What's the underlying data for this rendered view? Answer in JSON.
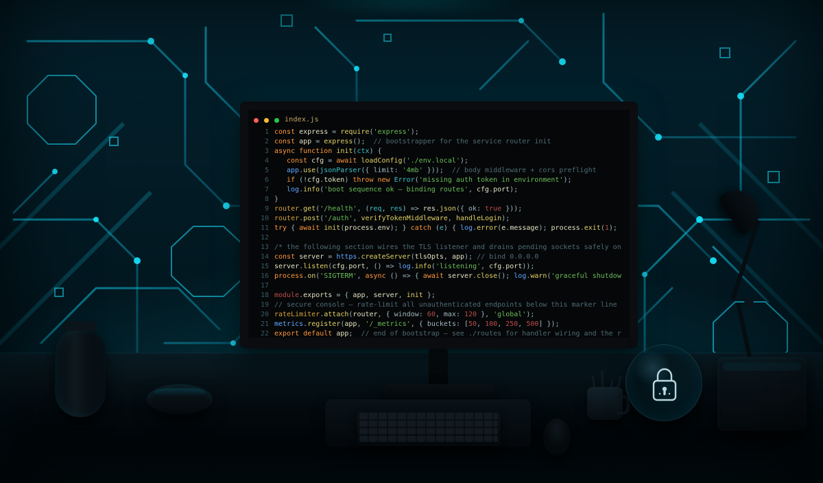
{
  "editor": {
    "title": "index.js",
    "lines": [
      {
        "n": 1,
        "ind": 0,
        "spans": [
          [
            "kw",
            "const "
          ],
          [
            "name",
            "express"
          ],
          [
            "op",
            " = "
          ],
          [
            "fn",
            "require"
          ],
          [
            "op",
            "("
          ],
          [
            "str",
            "'express'"
          ],
          [
            "op",
            ");"
          ]
        ]
      },
      {
        "n": 2,
        "ind": 0,
        "spans": [
          [
            "kw",
            "const "
          ],
          [
            "name",
            "app"
          ],
          [
            "op",
            " = "
          ],
          [
            "fn",
            "express"
          ],
          [
            "op",
            "();  "
          ],
          [
            "cm",
            "// bootstrapper for the service router init"
          ]
        ]
      },
      {
        "n": 3,
        "ind": 0,
        "spans": [
          [
            "kw",
            "async function "
          ],
          [
            "fn",
            "init"
          ],
          [
            "op",
            "("
          ],
          [
            "ty",
            "ctx"
          ],
          [
            "op",
            ") {"
          ]
        ]
      },
      {
        "n": 4,
        "ind": 1,
        "spans": [
          [
            "kw",
            "const "
          ],
          [
            "name",
            "cfg"
          ],
          [
            "op",
            " = "
          ],
          [
            "kw",
            "await "
          ],
          [
            "fn",
            "loadConfig"
          ],
          [
            "op",
            "("
          ],
          [
            "str",
            "'./env.local'"
          ],
          [
            "op",
            ");"
          ]
        ]
      },
      {
        "n": 5,
        "ind": 1,
        "spans": [
          [
            "blue",
            "app"
          ],
          [
            "op",
            "."
          ],
          [
            "fn",
            "use"
          ],
          [
            "op",
            "("
          ],
          [
            "ty",
            "jsonParser"
          ],
          [
            "op",
            "({ limit: "
          ],
          [
            "str",
            "'4mb'"
          ],
          [
            "op",
            " }));  "
          ],
          [
            "cm",
            "// body middleware + cors preflight"
          ]
        ]
      },
      {
        "n": 6,
        "ind": 1,
        "spans": [
          [
            "kw",
            "if"
          ],
          [
            "op",
            " (!"
          ],
          [
            "name",
            "cfg"
          ],
          [
            "op",
            "."
          ],
          [
            "name",
            "token"
          ],
          [
            "op",
            ") "
          ],
          [
            "kw",
            "throw new "
          ],
          [
            "ty",
            "Error"
          ],
          [
            "op",
            "("
          ],
          [
            "str",
            "'missing auth token in environment'"
          ],
          [
            "op",
            ");"
          ]
        ]
      },
      {
        "n": 7,
        "ind": 1,
        "spans": [
          [
            "blue",
            "log"
          ],
          [
            "op",
            "."
          ],
          [
            "fn",
            "info"
          ],
          [
            "op",
            "("
          ],
          [
            "str",
            "'boot sequence ok — binding routes'"
          ],
          [
            "op",
            ", "
          ],
          [
            "name",
            "cfg"
          ],
          [
            "op",
            "."
          ],
          [
            "name",
            "port"
          ],
          [
            "op",
            ");"
          ]
        ]
      },
      {
        "n": 8,
        "ind": 0,
        "spans": [
          [
            "op",
            "}"
          ]
        ]
      },
      {
        "n": 9,
        "ind": 0,
        "spans": [
          [
            "gold",
            "router"
          ],
          [
            "op",
            "."
          ],
          [
            "fn",
            "get"
          ],
          [
            "op",
            "("
          ],
          [
            "str",
            "'/health'"
          ],
          [
            "op",
            ", ("
          ],
          [
            "ty",
            "req"
          ],
          [
            "op",
            ", "
          ],
          [
            "ty",
            "res"
          ],
          [
            "op",
            ") => "
          ],
          [
            "name",
            "res"
          ],
          [
            "op",
            "."
          ],
          [
            "fn",
            "json"
          ],
          [
            "op",
            "({ ok: "
          ],
          [
            "lit",
            "true"
          ],
          [
            "op",
            " }));"
          ]
        ]
      },
      {
        "n": 10,
        "ind": 0,
        "spans": [
          [
            "gold",
            "router"
          ],
          [
            "op",
            "."
          ],
          [
            "fn",
            "post"
          ],
          [
            "op",
            "("
          ],
          [
            "str",
            "'/auth'"
          ],
          [
            "op",
            ", "
          ],
          [
            "fn",
            "verifyTokenMiddleware"
          ],
          [
            "op",
            ", "
          ],
          [
            "fn",
            "handleLogin"
          ],
          [
            "op",
            ");"
          ]
        ]
      },
      {
        "n": 11,
        "ind": 0,
        "spans": [
          [
            "kw",
            "try"
          ],
          [
            "op",
            " { "
          ],
          [
            "kw",
            "await "
          ],
          [
            "fn",
            "init"
          ],
          [
            "op",
            "("
          ],
          [
            "name",
            "process"
          ],
          [
            "op",
            "."
          ],
          [
            "name",
            "env"
          ],
          [
            "op",
            "); } "
          ],
          [
            "kw",
            "catch"
          ],
          [
            "op",
            " ("
          ],
          [
            "ty",
            "e"
          ],
          [
            "op",
            ") { "
          ],
          [
            "blue",
            "log"
          ],
          [
            "op",
            "."
          ],
          [
            "fn",
            "error"
          ],
          [
            "op",
            "("
          ],
          [
            "name",
            "e"
          ],
          [
            "op",
            "."
          ],
          [
            "name",
            "message"
          ],
          [
            "op",
            "); "
          ],
          [
            "name",
            "process"
          ],
          [
            "op",
            "."
          ],
          [
            "fn",
            "exit"
          ],
          [
            "op",
            "("
          ],
          [
            "lit",
            "1"
          ],
          [
            "op",
            "); }"
          ]
        ]
      },
      {
        "n": 12,
        "ind": 0,
        "spans": [
          [
            "op",
            ""
          ]
        ]
      },
      {
        "n": 13,
        "ind": 0,
        "spans": [
          [
            "cm",
            "/* the following section wires the TLS listener and drains pending sockets safely on SIGTERM shutdown */"
          ]
        ]
      },
      {
        "n": 14,
        "ind": 0,
        "spans": [
          [
            "kw",
            "const "
          ],
          [
            "name",
            "server"
          ],
          [
            "op",
            " = "
          ],
          [
            "blue",
            "https"
          ],
          [
            "op",
            "."
          ],
          [
            "fn",
            "createServer"
          ],
          [
            "op",
            "("
          ],
          [
            "name",
            "tlsOpts"
          ],
          [
            "op",
            ", "
          ],
          [
            "name",
            "app"
          ],
          [
            "op",
            "); "
          ],
          [
            "cm",
            "// bind 0.0.0.0"
          ]
        ]
      },
      {
        "n": 15,
        "ind": 0,
        "spans": [
          [
            "name",
            "server"
          ],
          [
            "op",
            "."
          ],
          [
            "fn",
            "listen"
          ],
          [
            "op",
            "("
          ],
          [
            "name",
            "cfg"
          ],
          [
            "op",
            "."
          ],
          [
            "name",
            "port"
          ],
          [
            "op",
            ", () => "
          ],
          [
            "blue",
            "log"
          ],
          [
            "op",
            "."
          ],
          [
            "fn",
            "info"
          ],
          [
            "op",
            "("
          ],
          [
            "str",
            "'listening'"
          ],
          [
            "op",
            ", "
          ],
          [
            "name",
            "cfg"
          ],
          [
            "op",
            "."
          ],
          [
            "name",
            "port"
          ],
          [
            "op",
            "));"
          ]
        ]
      },
      {
        "n": 16,
        "ind": 0,
        "spans": [
          [
            "kw",
            "process"
          ],
          [
            "op",
            "."
          ],
          [
            "fn",
            "on"
          ],
          [
            "op",
            "("
          ],
          [
            "str",
            "'SIGTERM'"
          ],
          [
            "op",
            ", "
          ],
          [
            "kw",
            "async"
          ],
          [
            "op",
            " () => { "
          ],
          [
            "kw",
            "await "
          ],
          [
            "name",
            "server"
          ],
          [
            "op",
            "."
          ],
          [
            "fn",
            "close"
          ],
          [
            "op",
            "(); "
          ],
          [
            "blue",
            "log"
          ],
          [
            "op",
            "."
          ],
          [
            "fn",
            "warn"
          ],
          [
            "op",
            "("
          ],
          [
            "str",
            "'graceful shutdown'"
          ],
          [
            "op",
            "); });"
          ]
        ]
      },
      {
        "n": 17,
        "ind": 0,
        "spans": [
          [
            "op",
            ""
          ]
        ]
      },
      {
        "n": 18,
        "ind": 0,
        "spans": [
          [
            "lit",
            "module"
          ],
          [
            "op",
            "."
          ],
          [
            "name",
            "exports"
          ],
          [
            "op",
            " = { "
          ],
          [
            "name",
            "app"
          ],
          [
            "op",
            ", "
          ],
          [
            "name",
            "server"
          ],
          [
            "op",
            ", "
          ],
          [
            "fn",
            "init"
          ],
          [
            "op",
            " };"
          ]
        ]
      },
      {
        "n": 19,
        "ind": 0,
        "spans": [
          [
            "cm",
            "// secure console — rate-limit all unauthenticated endpoints below this marker line always and forever"
          ]
        ]
      },
      {
        "n": 20,
        "ind": 0,
        "spans": [
          [
            "gold",
            "rateLimiter"
          ],
          [
            "op",
            "."
          ],
          [
            "fn",
            "attach"
          ],
          [
            "op",
            "("
          ],
          [
            "name",
            "router"
          ],
          [
            "op",
            ", { window: "
          ],
          [
            "lit",
            "60"
          ],
          [
            "op",
            ", max: "
          ],
          [
            "lit",
            "120"
          ],
          [
            "op",
            " }, "
          ],
          [
            "str",
            "'global'"
          ],
          [
            "op",
            ");"
          ]
        ]
      },
      {
        "n": 21,
        "ind": 0,
        "spans": [
          [
            "blue",
            "metrics"
          ],
          [
            "op",
            "."
          ],
          [
            "fn",
            "register"
          ],
          [
            "op",
            "("
          ],
          [
            "name",
            "app"
          ],
          [
            "op",
            ", "
          ],
          [
            "str",
            "'/_metrics'"
          ],
          [
            "op",
            ", { buckets: ["
          ],
          [
            "lit",
            "50"
          ],
          [
            "op",
            ", "
          ],
          [
            "lit",
            "100"
          ],
          [
            "op",
            ", "
          ],
          [
            "lit",
            "250"
          ],
          [
            "op",
            ", "
          ],
          [
            "lit",
            "500"
          ],
          [
            "op",
            "] });"
          ]
        ]
      },
      {
        "n": 22,
        "ind": 0,
        "spans": [
          [
            "kw",
            "export default "
          ],
          [
            "name",
            "app"
          ],
          [
            "op",
            ";  "
          ],
          [
            "cm",
            "// end of bootstrap — see ./routes for handler wiring and the rest of it"
          ]
        ]
      }
    ]
  },
  "icons": {
    "lock": "lock"
  }
}
